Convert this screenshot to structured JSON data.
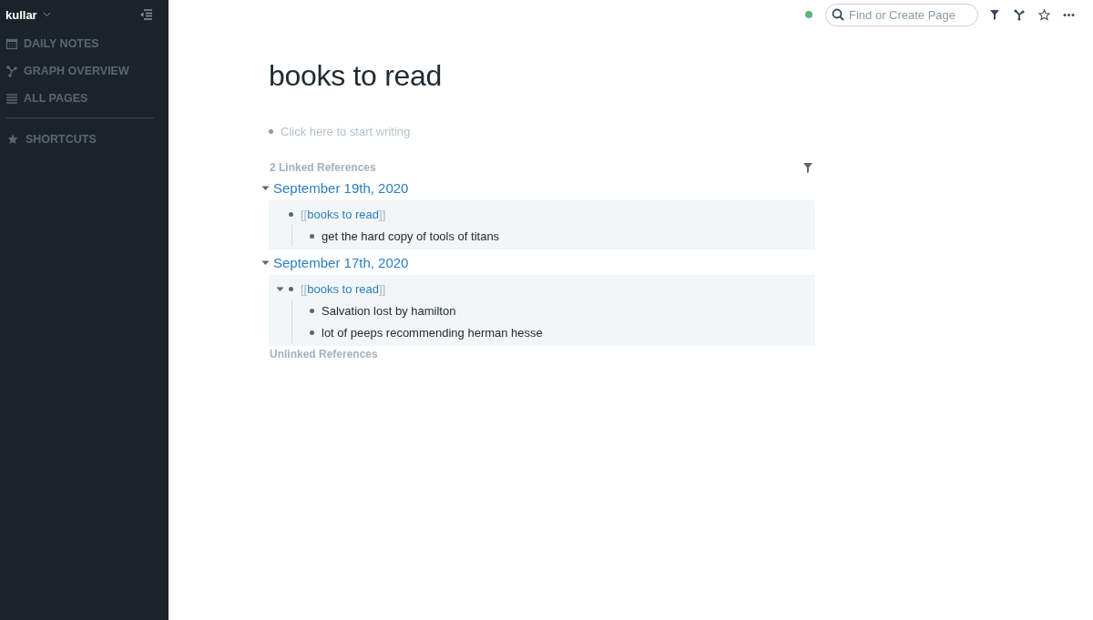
{
  "sidebar": {
    "graph_name": "kullar",
    "nav": [
      {
        "label": "DAILY NOTES",
        "kind": "calendar"
      },
      {
        "label": "GRAPH OVERVIEW",
        "kind": "graph"
      },
      {
        "label": "ALL PAGES",
        "kind": "list"
      }
    ],
    "shortcuts": {
      "label": "SHORTCUTS"
    }
  },
  "topbar": {
    "status": {
      "color": "#5fb37f"
    },
    "search": {
      "placeholder": "Find or Create Page"
    }
  },
  "page": {
    "title": "books to read",
    "empty_block": "Click here to start writing",
    "linked": {
      "heading": "2 Linked References",
      "groups": [
        {
          "date": "September 19th, 2020",
          "expanded": true,
          "blocks": [
            {
              "open": "[[",
              "link": "books to read",
              "close": "]]",
              "caret": false,
              "children": [
                "get the hard copy of tools of titans"
              ]
            }
          ]
        },
        {
          "date": "September 17th, 2020",
          "expanded": true,
          "blocks": [
            {
              "open": "[[",
              "link": "books to read",
              "close": "]]",
              "caret": true,
              "children": [
                "Salvation lost by hamilton",
                "lot of peeps recommending herman hesse"
              ]
            }
          ]
        }
      ]
    },
    "unlinked": {
      "heading": "Unlinked References"
    }
  }
}
